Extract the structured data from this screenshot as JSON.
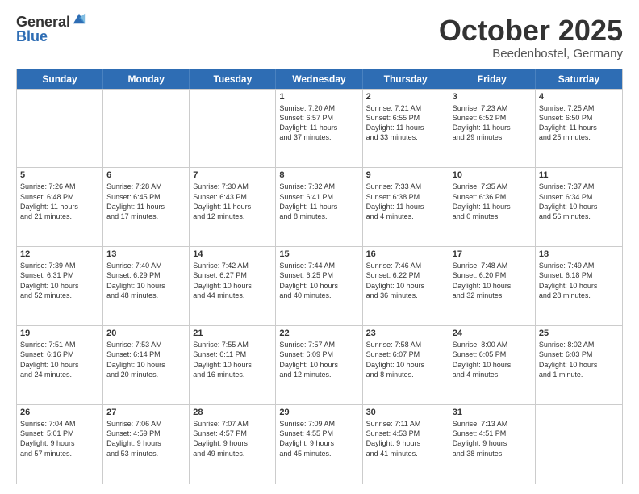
{
  "logo": {
    "general": "General",
    "blue": "Blue"
  },
  "title": "October 2025",
  "location": "Beedenbostel, Germany",
  "weekdays": [
    "Sunday",
    "Monday",
    "Tuesday",
    "Wednesday",
    "Thursday",
    "Friday",
    "Saturday"
  ],
  "weeks": [
    [
      {
        "day": "",
        "info": ""
      },
      {
        "day": "",
        "info": ""
      },
      {
        "day": "",
        "info": ""
      },
      {
        "day": "1",
        "info": "Sunrise: 7:20 AM\nSunset: 6:57 PM\nDaylight: 11 hours\nand 37 minutes."
      },
      {
        "day": "2",
        "info": "Sunrise: 7:21 AM\nSunset: 6:55 PM\nDaylight: 11 hours\nand 33 minutes."
      },
      {
        "day": "3",
        "info": "Sunrise: 7:23 AM\nSunset: 6:52 PM\nDaylight: 11 hours\nand 29 minutes."
      },
      {
        "day": "4",
        "info": "Sunrise: 7:25 AM\nSunset: 6:50 PM\nDaylight: 11 hours\nand 25 minutes."
      }
    ],
    [
      {
        "day": "5",
        "info": "Sunrise: 7:26 AM\nSunset: 6:48 PM\nDaylight: 11 hours\nand 21 minutes."
      },
      {
        "day": "6",
        "info": "Sunrise: 7:28 AM\nSunset: 6:45 PM\nDaylight: 11 hours\nand 17 minutes."
      },
      {
        "day": "7",
        "info": "Sunrise: 7:30 AM\nSunset: 6:43 PM\nDaylight: 11 hours\nand 12 minutes."
      },
      {
        "day": "8",
        "info": "Sunrise: 7:32 AM\nSunset: 6:41 PM\nDaylight: 11 hours\nand 8 minutes."
      },
      {
        "day": "9",
        "info": "Sunrise: 7:33 AM\nSunset: 6:38 PM\nDaylight: 11 hours\nand 4 minutes."
      },
      {
        "day": "10",
        "info": "Sunrise: 7:35 AM\nSunset: 6:36 PM\nDaylight: 11 hours\nand 0 minutes."
      },
      {
        "day": "11",
        "info": "Sunrise: 7:37 AM\nSunset: 6:34 PM\nDaylight: 10 hours\nand 56 minutes."
      }
    ],
    [
      {
        "day": "12",
        "info": "Sunrise: 7:39 AM\nSunset: 6:31 PM\nDaylight: 10 hours\nand 52 minutes."
      },
      {
        "day": "13",
        "info": "Sunrise: 7:40 AM\nSunset: 6:29 PM\nDaylight: 10 hours\nand 48 minutes."
      },
      {
        "day": "14",
        "info": "Sunrise: 7:42 AM\nSunset: 6:27 PM\nDaylight: 10 hours\nand 44 minutes."
      },
      {
        "day": "15",
        "info": "Sunrise: 7:44 AM\nSunset: 6:25 PM\nDaylight: 10 hours\nand 40 minutes."
      },
      {
        "day": "16",
        "info": "Sunrise: 7:46 AM\nSunset: 6:22 PM\nDaylight: 10 hours\nand 36 minutes."
      },
      {
        "day": "17",
        "info": "Sunrise: 7:48 AM\nSunset: 6:20 PM\nDaylight: 10 hours\nand 32 minutes."
      },
      {
        "day": "18",
        "info": "Sunrise: 7:49 AM\nSunset: 6:18 PM\nDaylight: 10 hours\nand 28 minutes."
      }
    ],
    [
      {
        "day": "19",
        "info": "Sunrise: 7:51 AM\nSunset: 6:16 PM\nDaylight: 10 hours\nand 24 minutes."
      },
      {
        "day": "20",
        "info": "Sunrise: 7:53 AM\nSunset: 6:14 PM\nDaylight: 10 hours\nand 20 minutes."
      },
      {
        "day": "21",
        "info": "Sunrise: 7:55 AM\nSunset: 6:11 PM\nDaylight: 10 hours\nand 16 minutes."
      },
      {
        "day": "22",
        "info": "Sunrise: 7:57 AM\nSunset: 6:09 PM\nDaylight: 10 hours\nand 12 minutes."
      },
      {
        "day": "23",
        "info": "Sunrise: 7:58 AM\nSunset: 6:07 PM\nDaylight: 10 hours\nand 8 minutes."
      },
      {
        "day": "24",
        "info": "Sunrise: 8:00 AM\nSunset: 6:05 PM\nDaylight: 10 hours\nand 4 minutes."
      },
      {
        "day": "25",
        "info": "Sunrise: 8:02 AM\nSunset: 6:03 PM\nDaylight: 10 hours\nand 1 minute."
      }
    ],
    [
      {
        "day": "26",
        "info": "Sunrise: 7:04 AM\nSunset: 5:01 PM\nDaylight: 9 hours\nand 57 minutes."
      },
      {
        "day": "27",
        "info": "Sunrise: 7:06 AM\nSunset: 4:59 PM\nDaylight: 9 hours\nand 53 minutes."
      },
      {
        "day": "28",
        "info": "Sunrise: 7:07 AM\nSunset: 4:57 PM\nDaylight: 9 hours\nand 49 minutes."
      },
      {
        "day": "29",
        "info": "Sunrise: 7:09 AM\nSunset: 4:55 PM\nDaylight: 9 hours\nand 45 minutes."
      },
      {
        "day": "30",
        "info": "Sunrise: 7:11 AM\nSunset: 4:53 PM\nDaylight: 9 hours\nand 41 minutes."
      },
      {
        "day": "31",
        "info": "Sunrise: 7:13 AM\nSunset: 4:51 PM\nDaylight: 9 hours\nand 38 minutes."
      },
      {
        "day": "",
        "info": ""
      }
    ]
  ]
}
